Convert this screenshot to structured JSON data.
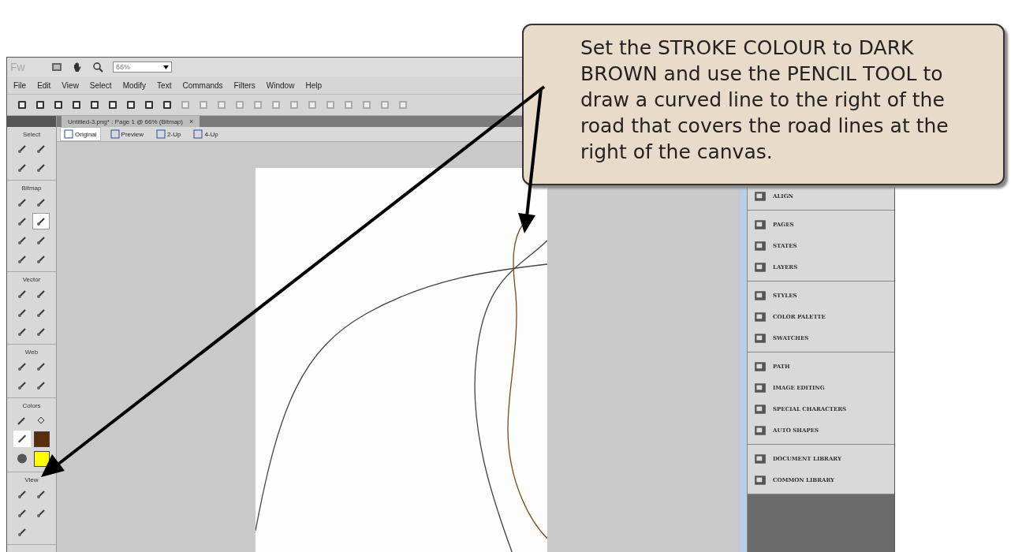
{
  "app_bar": {
    "logo": "Fw",
    "zoom": "66%"
  },
  "menu": [
    "File",
    "Edit",
    "View",
    "Select",
    "Modify",
    "Text",
    "Commands",
    "Filters",
    "Window",
    "Help"
  ],
  "document_tab": {
    "title": "Untitled-3.png* : Page 1 @ 66% (Bitmap)",
    "close": "×"
  },
  "view_tabs": [
    {
      "label": "Original",
      "selected": true
    },
    {
      "label": "Preview",
      "selected": false
    },
    {
      "label": "2-Up",
      "selected": false
    },
    {
      "label": "4-Up",
      "selected": false
    }
  ],
  "tools": [
    {
      "title": "Select",
      "tools": [
        {
          "selected": false
        },
        {
          "selected": false
        },
        {
          "selected": false
        },
        {
          "selected": false
        }
      ]
    },
    {
      "title": "Bitmap",
      "tools": [
        {
          "selected": false
        },
        {
          "selected": false
        },
        {
          "selected": false
        },
        {
          "selected": true
        },
        {
          "selected": false
        },
        {
          "selected": false
        },
        {
          "selected": false
        },
        {
          "selected": false
        }
      ]
    },
    {
      "title": "Vector",
      "tools": [
        {
          "selected": false
        },
        {
          "selected": false
        },
        {
          "selected": false
        },
        {
          "selected": false
        },
        {
          "selected": false
        },
        {
          "selected": false
        }
      ]
    },
    {
      "title": "Web",
      "tools": [
        {
          "selected": false
        },
        {
          "selected": false
        },
        {
          "selected": false
        },
        {
          "selected": false
        }
      ]
    },
    {
      "title": "Colors",
      "color_swatches": [
        {
          "color": "#5a2d0c"
        },
        {
          "color": "#ffff00"
        }
      ]
    },
    {
      "title": "View",
      "tools": [
        {
          "selected": false
        },
        {
          "selected": false
        },
        {
          "selected": false
        },
        {
          "selected": false
        },
        {
          "selected": false
        }
      ]
    }
  ],
  "panels": [
    [
      "ALIGN"
    ],
    [
      "PAGES",
      "STATES",
      "LAYERS"
    ],
    [
      "STYLES",
      "COLOR PALETTE",
      "SWATCHES"
    ],
    [
      "PATH",
      "IMAGE EDITING",
      "SPECIAL CHARACTERS",
      "AUTO SHAPES"
    ],
    [
      "DOCUMENT LIBRARY",
      "COMMON LIBRARY"
    ]
  ],
  "callout": {
    "text": "Set the STROKE COLOUR to DARK BROWN and use the PENCIL TOOL to draw a curved line to the right of the road that covers the road lines at the right of the canvas."
  }
}
